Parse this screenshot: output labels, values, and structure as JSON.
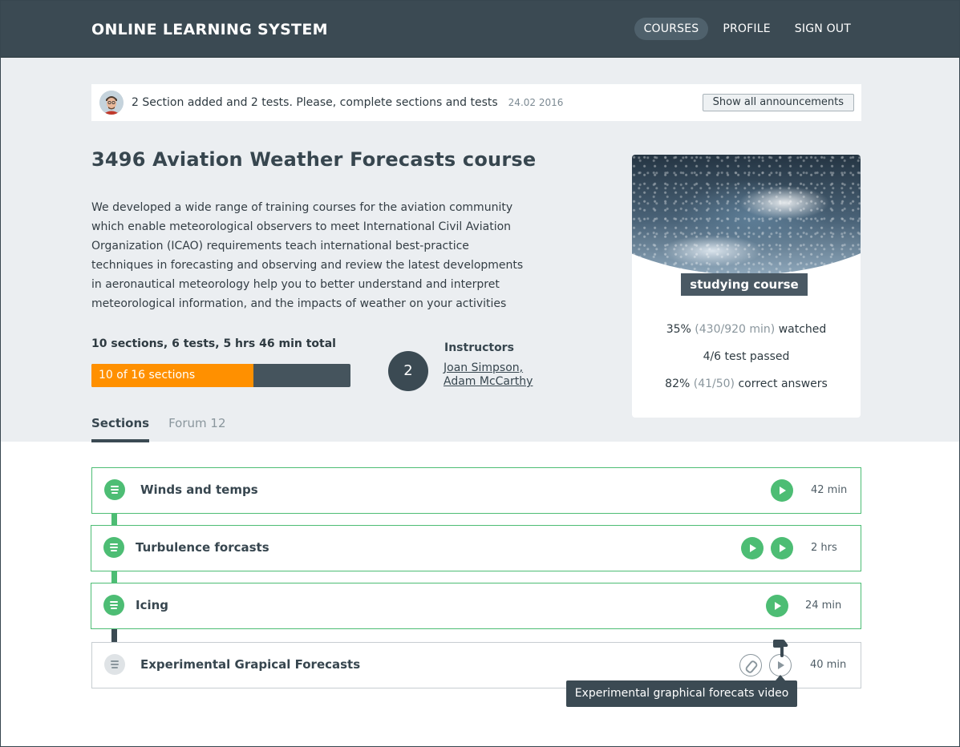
{
  "header": {
    "brand": "ONLINE LEARNING SYSTEM",
    "nav": [
      {
        "label": "COURSES",
        "active": true
      },
      {
        "label": "PROFILE",
        "active": false
      },
      {
        "label": "SIGN OUT",
        "active": false
      }
    ]
  },
  "announcement": {
    "message": "2 Section added and 2 tests. Please, complete sections and tests",
    "date": "24.02 2016",
    "button_label": "Show all announcements",
    "avatar_icon": "user-avatar-icon"
  },
  "course": {
    "title": "3496 Aviation Weather Forecasts course",
    "description": "We developed a wide range of training courses for the aviation community which enable meteorological observers to meet International Civil Aviation Organization (ICAO) requirements teach international best-practice techniques in forecasting and observing and review the latest developments in aeronautical meteorology help you to better understand and interpret meteorological information, and the impacts of weather on your activities",
    "totals": "10 sections, 6 tests, 5 hrs 46 min total",
    "progress": {
      "label": "10 of 16 sections",
      "completed": 10,
      "total": 16
    },
    "instructors": {
      "count": "2",
      "title": "Instructors",
      "names": [
        "Joan Simpson,",
        "Adam McCarthy"
      ]
    }
  },
  "tabs": [
    {
      "label": "Sections",
      "active": true
    },
    {
      "label": "Forum 12",
      "active": false
    }
  ],
  "status_card": {
    "badge": "studying course",
    "watched": {
      "percent": "35%",
      "detail": "(430/920 min)",
      "suffix": "watched"
    },
    "tests": "4/6 test passed",
    "answers": {
      "percent": "82%",
      "detail": "(41/50)",
      "suffix": "correct answers"
    }
  },
  "sections": [
    {
      "title": "Winds and temps",
      "duration": "42 min",
      "status": "done",
      "videos": 1,
      "attachment": false
    },
    {
      "title": "Turbulence forcasts",
      "duration": "2 hrs",
      "status": "done",
      "videos": 2,
      "attachment": false
    },
    {
      "title": "Icing",
      "duration": "24 min",
      "status": "done",
      "videos": 1,
      "attachment": false
    },
    {
      "title": "Experimental Grapical Forecasts",
      "duration": "40 min",
      "status": "pending",
      "videos": 1,
      "attachment": true
    }
  ],
  "tooltip": "Experimental graphical forecats video",
  "colors": {
    "header_bg": "#3b4a53",
    "hero_bg": "#ebeef1",
    "accent_green": "#4dbd74",
    "progress_orange": "#ff9000",
    "dark": "#37464f"
  }
}
